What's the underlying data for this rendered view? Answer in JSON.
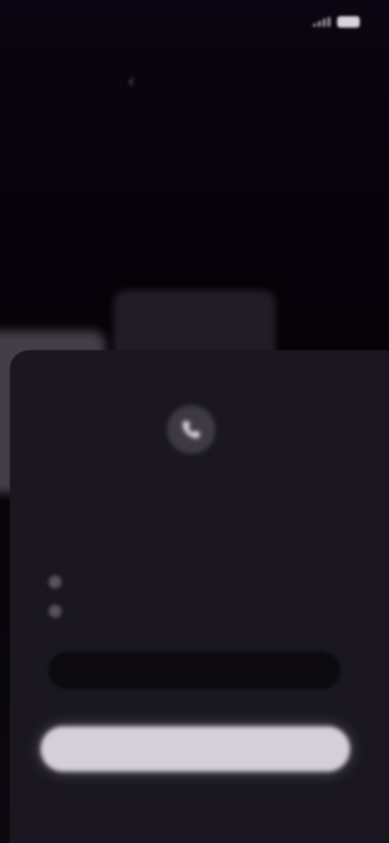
{
  "status_bar": {
    "time": "",
    "icons": [
      "signal-icon",
      "battery-icon"
    ]
  },
  "header": {
    "back_label": "‹",
    "title": "",
    "subtitle": ""
  },
  "card": {
    "icon": "phone-icon",
    "title": "",
    "features": [
      {
        "text": ""
      },
      {
        "text": ""
      }
    ],
    "secondary_button_label": "",
    "primary_button_label": ""
  },
  "colors": {
    "background": "#07030a",
    "card": "#1a1720",
    "primary_button": "#d4cfd8",
    "secondary_button": "#0c0a0f"
  }
}
